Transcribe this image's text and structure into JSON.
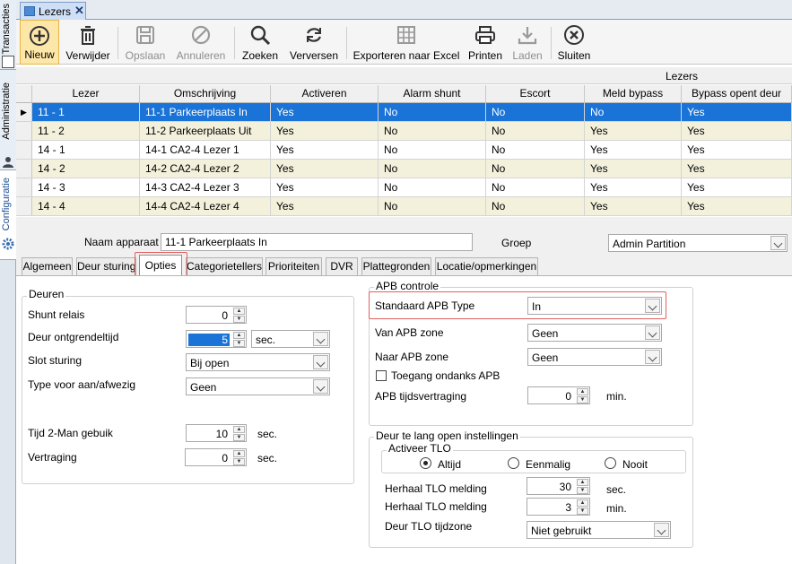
{
  "side_tabs": [
    "Transacties",
    "Administratie",
    "Configuratie"
  ],
  "document_tab": {
    "title": "Lezers",
    "close": "✕"
  },
  "toolbar": {
    "nieuw": "Nieuw",
    "verwijder": "Verwijder",
    "opslaan": "Opslaan",
    "annuleren": "Annuleren",
    "zoeken": "Zoeken",
    "verversen": "Verversen",
    "exporteren": "Exporteren naar Excel",
    "printen": "Printen",
    "laden": "Laden",
    "sluiten": "Sluiten"
  },
  "grid": {
    "band_title": "Lezers",
    "columns": [
      "Lezer",
      "Omschrijving",
      "Activeren",
      "Alarm shunt",
      "Escort",
      "Meld bypass",
      "Bypass opent deur"
    ],
    "rows": [
      [
        "11 - 1",
        "11-1 Parkeerplaats In",
        "Yes",
        "No",
        "No",
        "No",
        "Yes"
      ],
      [
        "11 - 2",
        "11-2 Parkeerplaats Uit",
        "Yes",
        "No",
        "No",
        "Yes",
        "Yes"
      ],
      [
        "14 - 1",
        "14-1 CA2-4 Lezer 1",
        "Yes",
        "No",
        "No",
        "Yes",
        "Yes"
      ],
      [
        "14 - 2",
        "14-2 CA2-4 Lezer 2",
        "Yes",
        "No",
        "No",
        "Yes",
        "Yes"
      ],
      [
        "14 - 3",
        "14-3 CA2-4 Lezer 3",
        "Yes",
        "No",
        "No",
        "Yes",
        "Yes"
      ],
      [
        "14 - 4",
        "14-4 CA2-4 Lezer 4",
        "Yes",
        "No",
        "No",
        "Yes",
        "Yes"
      ]
    ],
    "selected_row": 0
  },
  "form": {
    "naam_label": "Naam apparaat",
    "naam_value": "11-1 Parkeerplaats In",
    "groep_label": "Groep",
    "groep_value": "Admin Partition"
  },
  "inner_tabs": [
    "Algemeen",
    "Deur sturing",
    "Opties",
    "Categorietellers",
    "Prioriteiten",
    "DVR",
    "Plattegronden",
    "Locatie/opmerkingen"
  ],
  "active_inner_tab": "Opties",
  "deuren": {
    "title": "Deuren",
    "shunt_label": "Shunt relais",
    "shunt_value": "0",
    "ontgrendel_label": "Deur ontgrendeltijd",
    "ontgrendel_value": "5",
    "ontgrendel_unit": "sec.",
    "slot_label": "Slot sturing",
    "slot_value": "Bij open",
    "type_label": "Type voor aan/afwezig",
    "type_value": "Geen",
    "tijd2man_label": "Tijd 2-Man gebuik",
    "tijd2man_value": "10",
    "tijd2man_unit": "sec.",
    "vertraging_label": "Vertraging",
    "vertraging_value": "0",
    "vertraging_unit": "sec."
  },
  "apb": {
    "title": "APB controle",
    "standaard_label": "Standaard APB Type",
    "standaard_value": "In",
    "van_label": "Van APB zone",
    "van_value": "Geen",
    "naar_label": "Naar APB zone",
    "naar_value": "Geen",
    "toegang_label": "Toegang ondanks APB",
    "toegang_checked": false,
    "tijds_label": "APB tijdsvertraging",
    "tijds_value": "0",
    "tijds_unit": "min."
  },
  "tlo": {
    "title": "Deur te lang open instellingen",
    "activeer_title": "Activeer TLO",
    "radio_altijd": "Altijd",
    "radio_eenmalig": "Eenmalig",
    "radio_nooit": "Nooit",
    "selected": "Altijd",
    "herhaal1_label": "Herhaal TLO melding",
    "herhaal1_value": "30",
    "herhaal1_unit": "sec.",
    "herhaal2_label": "Herhaal TLO melding",
    "herhaal2_value": "3",
    "herhaal2_unit": "min.",
    "tijdzone_label": "Deur TLO tijdzone",
    "tijdzone_value": "Niet gebruikt"
  },
  "colors": {
    "selection": "#1a73d6",
    "row_alt": "#f3f1dc",
    "highlight_box": "#e0605e"
  }
}
